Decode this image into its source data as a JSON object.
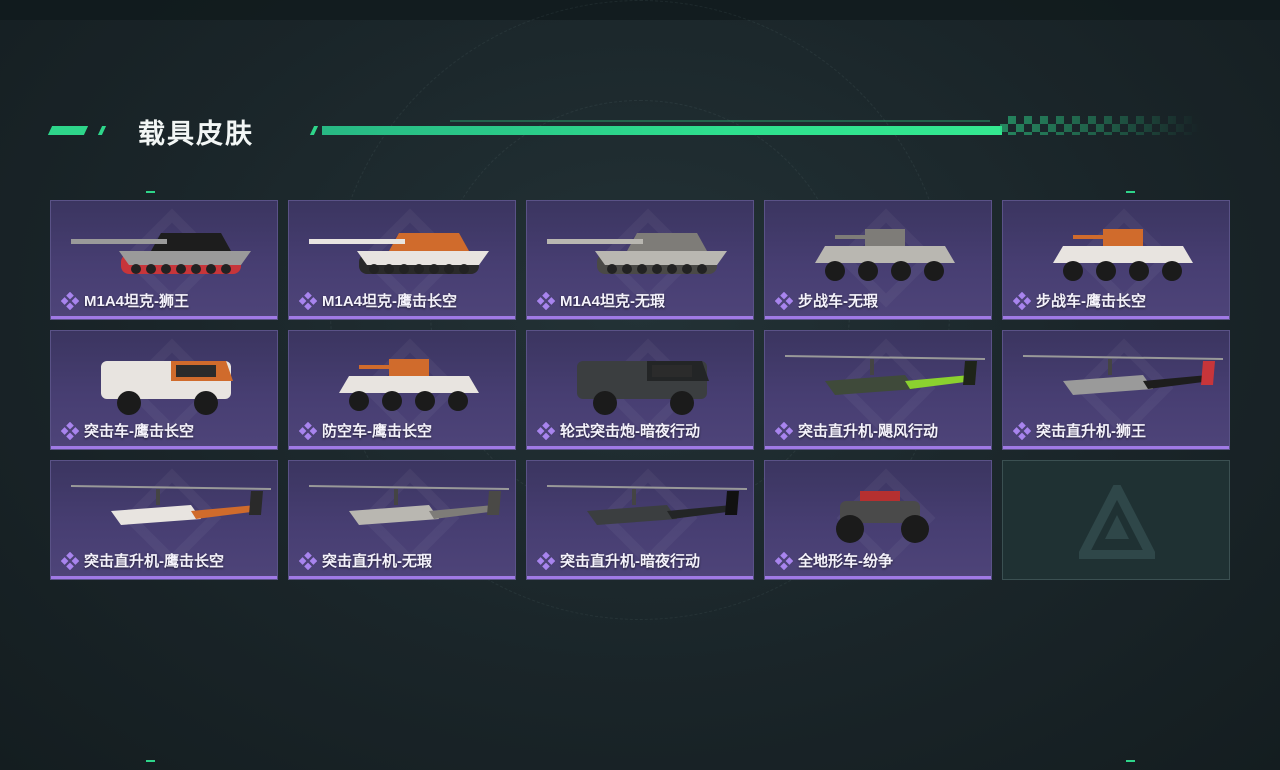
{
  "header": {
    "title": "载具皮肤"
  },
  "colors": {
    "accent": "#2ed58a",
    "card_bg": "#463d70",
    "card_rule": "#a07ae6",
    "empty_bg": "#1f3133"
  },
  "skins": [
    {
      "label": "M1A4坦克-狮王",
      "icon": "tank-lion-icon"
    },
    {
      "label": "M1A4坦克-鹰击长空",
      "icon": "tank-eagle-icon"
    },
    {
      "label": "M1A4坦克-无瑕",
      "icon": "tank-flawless-icon"
    },
    {
      "label": "步战车-无瑕",
      "icon": "ifv-flawless-icon"
    },
    {
      "label": "步战车-鹰击长空",
      "icon": "ifv-eagle-icon"
    },
    {
      "label": "突击车-鹰击长空",
      "icon": "assault-car-eagle-icon"
    },
    {
      "label": "防空车-鹰击长空",
      "icon": "aa-vehicle-eagle-icon"
    },
    {
      "label": "轮式突击炮-暗夜行动",
      "icon": "wheeled-assault-gun-night-icon"
    },
    {
      "label": "突击直升机-飓风行动",
      "icon": "helicopter-hurricane-icon"
    },
    {
      "label": "突击直升机-狮王",
      "icon": "helicopter-lion-icon"
    },
    {
      "label": "突击直升机-鹰击长空",
      "icon": "helicopter-eagle-icon"
    },
    {
      "label": "突击直升机-无瑕",
      "icon": "helicopter-flawless-icon"
    },
    {
      "label": "突击直升机-暗夜行动",
      "icon": "helicopter-night-icon"
    },
    {
      "label": "全地形车-纷争",
      "icon": "atv-strife-icon"
    }
  ]
}
